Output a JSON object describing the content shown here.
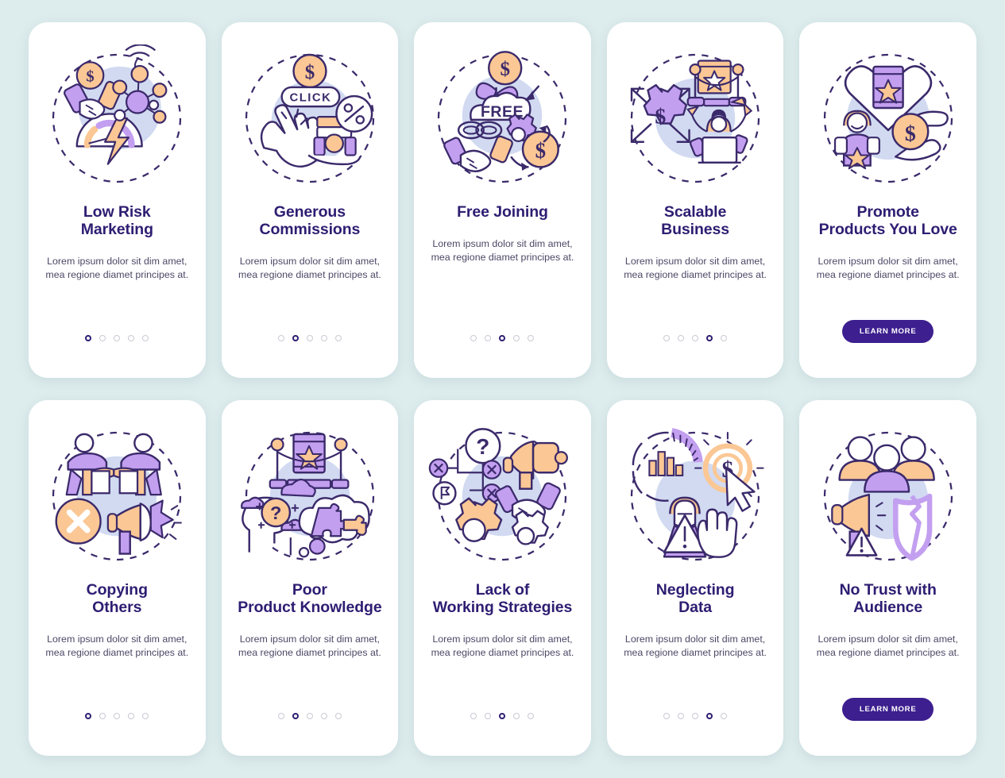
{
  "page": {
    "background_color": "#ddeced",
    "card_background": "#ffffff",
    "title_color": "#2e1d72",
    "body_color": "#4c4866",
    "button_color": "#3d1f8f",
    "accent_purple": "#c39ff0",
    "accent_peach": "#fbc794",
    "accent_lavender": "#c9d3ee"
  },
  "cards": [
    {
      "id": "low-risk-marketing",
      "illustration": "handshake-dollar-network-gauge-icon",
      "title": "Low Risk\nMarketing",
      "body": "Lorem ipsum dolor sit dim amet, mea regione diamet principes at.",
      "dots": {
        "count": 5,
        "active": 0
      },
      "button": null
    },
    {
      "id": "generous-commissions",
      "illustration": "click-cursor-dollar-discount-icon",
      "title": "Generous\nCommissions",
      "body": "Lorem ipsum dolor sit dim amet, mea regione diamet principes at.",
      "dots": {
        "count": 5,
        "active": 1
      },
      "button": null
    },
    {
      "id": "free-joining",
      "illustration": "free-plant-handshake-gear-dollar-icon",
      "title": "Free Joining",
      "body": "Lorem ipsum dolor sit dim amet, mea regione diamet principes at.",
      "dots": {
        "count": 5,
        "active": 2
      },
      "button": null
    },
    {
      "id": "scalable-business",
      "illustration": "gear-dollar-arrows-person-laptop-icon",
      "title": "Scalable\nBusiness",
      "body": "Lorem ipsum dolor sit dim amet, mea regione diamet principes at.",
      "dots": {
        "count": 5,
        "active": 3
      },
      "button": null
    },
    {
      "id": "promote-products-you-love",
      "illustration": "heart-product-person-hand-coin-icon",
      "title": "Promote\nProducts You Love",
      "body": "Lorem ipsum dolor sit dim amet, mea regione diamet principes at.",
      "dots": null,
      "button": "LEARN MORE"
    },
    {
      "id": "copying-others",
      "illustration": "mirror-people-cross-megaphone-icon",
      "title": "Copying\nOthers",
      "body": "Lorem ipsum dolor sit dim amet, mea regione diamet principes at.",
      "dots": {
        "count": 5,
        "active": 0
      },
      "button": null
    },
    {
      "id": "poor-product-knowledge",
      "illustration": "head-question-puzzle-cloud-icon",
      "title": "Poor\nProduct Knowledge",
      "body": "Lorem ipsum dolor sit dim amet, mea regione diamet principes at.",
      "dots": {
        "count": 5,
        "active": 1
      },
      "button": null
    },
    {
      "id": "lack-of-working-strategies",
      "illustration": "flowchart-question-megaphone-gears-icon",
      "title": "Lack of\nWorking Strategies",
      "body": "Lorem ipsum dolor sit dim amet, mea regione diamet principes at.",
      "dots": {
        "count": 5,
        "active": 2
      },
      "button": null
    },
    {
      "id": "neglecting-data",
      "illustration": "chart-dollar-cursor-warning-person-icon",
      "title": "Neglecting\nData",
      "body": "Lorem ipsum dolor sit dim amet, mea regione diamet principes at.",
      "dots": {
        "count": 5,
        "active": 3
      },
      "button": null
    },
    {
      "id": "no-trust-with-audience",
      "illustration": "people-megaphone-broken-shield-icon",
      "title": "No Trust with\nAudience",
      "body": "Lorem ipsum dolor sit dim amet, mea regione diamet principes at.",
      "dots": null,
      "button": "LEARN MORE"
    }
  ]
}
